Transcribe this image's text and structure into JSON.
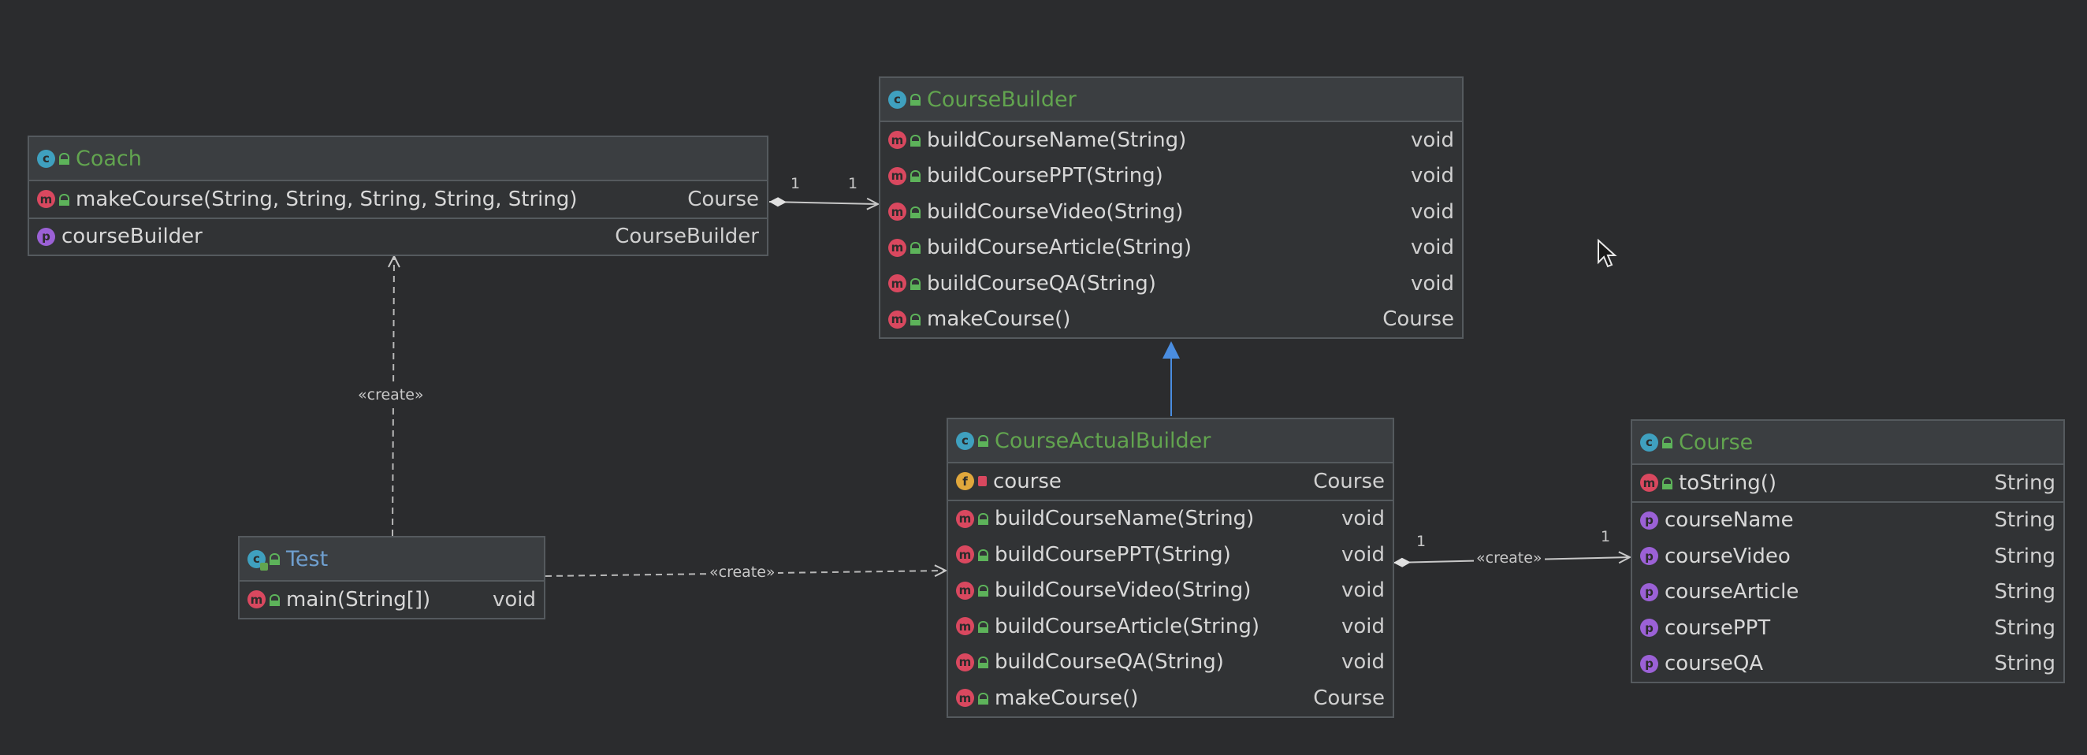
{
  "diagram": {
    "nodes": {
      "coach": {
        "title": "Coach",
        "methods": [
          {
            "name": "makeCourse(String, String, String, String, String)",
            "type": "Course"
          }
        ],
        "fields": [
          {
            "name": "courseBuilder",
            "type": "CourseBuilder"
          }
        ]
      },
      "course_builder": {
        "title": "CourseBuilder",
        "methods": [
          {
            "name": "buildCourseName(String)",
            "type": "void"
          },
          {
            "name": "buildCoursePPT(String)",
            "type": "void"
          },
          {
            "name": "buildCourseVideo(String)",
            "type": "void"
          },
          {
            "name": "buildCourseArticle(String)",
            "type": "void"
          },
          {
            "name": "buildCourseQA(String)",
            "type": "void"
          },
          {
            "name": "makeCourse()",
            "type": "Course"
          }
        ]
      },
      "test": {
        "title": "Test",
        "methods": [
          {
            "name": "main(String[])",
            "type": "void"
          }
        ]
      },
      "course_actual_builder": {
        "title": "CourseActualBuilder",
        "fields": [
          {
            "name": "course",
            "type": "Course"
          }
        ],
        "methods": [
          {
            "name": "buildCourseName(String)",
            "type": "void"
          },
          {
            "name": "buildCoursePPT(String)",
            "type": "void"
          },
          {
            "name": "buildCourseVideo(String)",
            "type": "void"
          },
          {
            "name": "buildCourseArticle(String)",
            "type": "void"
          },
          {
            "name": "buildCourseQA(String)",
            "type": "void"
          },
          {
            "name": "makeCourse()",
            "type": "Course"
          }
        ]
      },
      "course": {
        "title": "Course",
        "methods": [
          {
            "name": "toString()",
            "type": "String"
          }
        ],
        "fields": [
          {
            "name": "courseName",
            "type": "String"
          },
          {
            "name": "courseVideo",
            "type": "String"
          },
          {
            "name": "courseArticle",
            "type": "String"
          },
          {
            "name": "coursePPT",
            "type": "String"
          },
          {
            "name": "courseQA",
            "type": "String"
          }
        ]
      }
    },
    "edges": {
      "coach_builder": {
        "mult_source": "1",
        "mult_target": "1"
      },
      "test_coach": {
        "label": "«create»"
      },
      "test_actual": {
        "label": "«create»"
      },
      "actual_course": {
        "label": "«create»",
        "mult_source": "1",
        "mult_target": "1"
      }
    },
    "badges": {
      "class": "c",
      "method": "m",
      "property": "p",
      "field": "f"
    }
  }
}
